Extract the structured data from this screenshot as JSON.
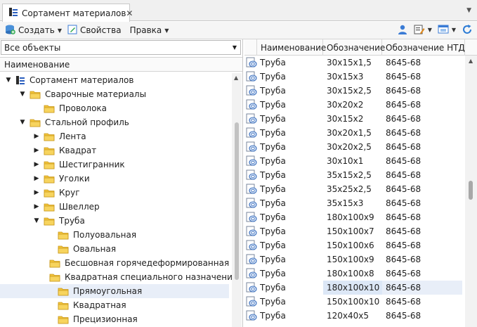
{
  "tab": {
    "title": "Сортамент материалов",
    "close": "✕",
    "dropdown": "▼"
  },
  "toolbar": {
    "create": "Создать",
    "properties": "Свойства",
    "edit": "Правка"
  },
  "filter": {
    "value": "Все объекты"
  },
  "tree": {
    "header": "Наименование",
    "items": [
      {
        "label": "Сортамент материалов",
        "level": 0,
        "expander": "▼",
        "icon": "catalog-icon"
      },
      {
        "label": "Сварочные материалы",
        "level": 1,
        "expander": "▼",
        "icon": "folder-icon"
      },
      {
        "label": "Проволока",
        "level": 2,
        "expander": "",
        "icon": "folder-icon"
      },
      {
        "label": "Стальной профиль",
        "level": 1,
        "expander": "▼",
        "icon": "folder-icon"
      },
      {
        "label": "Лента",
        "level": 2,
        "expander": "▶",
        "icon": "folder-icon"
      },
      {
        "label": "Квадрат",
        "level": 2,
        "expander": "▶",
        "icon": "folder-icon"
      },
      {
        "label": "Шестигранник",
        "level": 2,
        "expander": "▶",
        "icon": "folder-icon"
      },
      {
        "label": "Уголки",
        "level": 2,
        "expander": "▶",
        "icon": "folder-icon"
      },
      {
        "label": "Круг",
        "level": 2,
        "expander": "▶",
        "icon": "folder-icon"
      },
      {
        "label": "Швеллер",
        "level": 2,
        "expander": "▶",
        "icon": "folder-icon"
      },
      {
        "label": "Труба",
        "level": 2,
        "expander": "▼",
        "icon": "folder-icon"
      },
      {
        "label": "Полуовальная",
        "level": 3,
        "expander": "",
        "icon": "folder-icon"
      },
      {
        "label": "Овальная",
        "level": 3,
        "expander": "",
        "icon": "folder-icon"
      },
      {
        "label": "Бесшовная горячедеформированная",
        "level": 3,
        "expander": "",
        "icon": "folder-icon"
      },
      {
        "label": "Квадратная специального назначения",
        "level": 3,
        "expander": "",
        "icon": "folder-icon"
      },
      {
        "label": "Прямоугольная",
        "level": 3,
        "expander": "",
        "icon": "folder-icon",
        "selected": true
      },
      {
        "label": "Квадратная",
        "level": 3,
        "expander": "",
        "icon": "folder-icon"
      },
      {
        "label": "Прецизионная",
        "level": 3,
        "expander": "",
        "icon": "folder-icon"
      }
    ]
  },
  "grid": {
    "columns": [
      "Наименование",
      "Обозначение",
      "Обозначение НТД"
    ],
    "rows": [
      {
        "name": "Труба",
        "code": "30x15x1,5",
        "std": "8645-68"
      },
      {
        "name": "Труба",
        "code": "30x15x3",
        "std": "8645-68"
      },
      {
        "name": "Труба",
        "code": "30x15x2,5",
        "std": "8645-68"
      },
      {
        "name": "Труба",
        "code": "30x20x2",
        "std": "8645-68"
      },
      {
        "name": "Труба",
        "code": "30x15x2",
        "std": "8645-68"
      },
      {
        "name": "Труба",
        "code": "30x20x1,5",
        "std": "8645-68"
      },
      {
        "name": "Труба",
        "code": "30x20x2,5",
        "std": "8645-68"
      },
      {
        "name": "Труба",
        "code": "30x10x1",
        "std": "8645-68"
      },
      {
        "name": "Труба",
        "code": "35x15x2,5",
        "std": "8645-68"
      },
      {
        "name": "Труба",
        "code": "35x25x2,5",
        "std": "8645-68"
      },
      {
        "name": "Труба",
        "code": "35x15x3",
        "std": "8645-68"
      },
      {
        "name": "Труба",
        "code": "180x100x9",
        "std": "8645-68"
      },
      {
        "name": "Труба",
        "code": "150x100x7",
        "std": "8645-68"
      },
      {
        "name": "Труба",
        "code": "150x100x6",
        "std": "8645-68"
      },
      {
        "name": "Труба",
        "code": "150x100x9",
        "std": "8645-68"
      },
      {
        "name": "Труба",
        "code": "180x100x8",
        "std": "8645-68"
      },
      {
        "name": "Труба",
        "code": "180x100x10",
        "std": "8645-68",
        "selected": true
      },
      {
        "name": "Труба",
        "code": "150x100x10",
        "std": "8645-68"
      },
      {
        "name": "Труба",
        "code": "120x40x5",
        "std": "8645-68"
      }
    ]
  },
  "colors": {
    "folder": "#f3c43a",
    "accent": "#2b5fbf",
    "selection": "#e8eef8"
  }
}
